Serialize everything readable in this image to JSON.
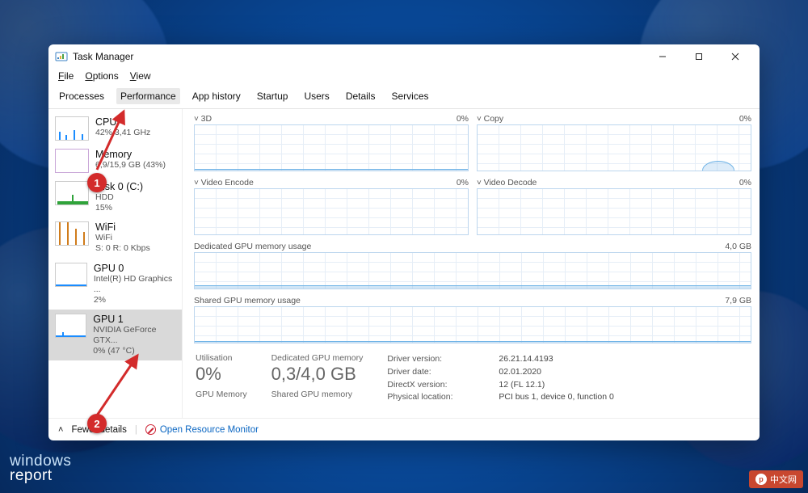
{
  "window": {
    "title": "Task Manager"
  },
  "menu": {
    "file": "File",
    "options": "Options",
    "view": "View"
  },
  "tabs": {
    "processes": "Processes",
    "performance": "Performance",
    "app_history": "App history",
    "startup": "Startup",
    "users": "Users",
    "details": "Details",
    "services": "Services"
  },
  "sidebar": {
    "cpu": {
      "name": "CPU",
      "sub": "42%  3,41 GHz"
    },
    "memory": {
      "name": "Memory",
      "sub": "6,9/15,9 GB (43%)"
    },
    "disk": {
      "name": "Disk 0 (C:)",
      "sub": "HDD\n15%"
    },
    "wifi": {
      "name": "WiFi",
      "sub": "WiFi\nS: 0 R: 0 Kbps"
    },
    "gpu0": {
      "name": "GPU 0",
      "sub": "Intel(R) HD Graphics ...\n2%"
    },
    "gpu1": {
      "name": "GPU 1",
      "sub": "NVIDIA GeForce GTX...\n0%  (47 °C)"
    }
  },
  "graphs": {
    "tl": {
      "name": "3D",
      "right": "0%"
    },
    "tr": {
      "name": "Copy",
      "right": "0%"
    },
    "ml": {
      "name": "Video Encode",
      "right": "0%"
    },
    "mr": {
      "name": "Video Decode",
      "right": "0%"
    },
    "dedicated": {
      "name": "Dedicated GPU memory usage",
      "right": "4,0 GB"
    },
    "shared": {
      "name": "Shared GPU memory usage",
      "right": "7,9 GB"
    }
  },
  "stats": {
    "util": {
      "label": "Utilisation",
      "value": "0%",
      "sublabel": "GPU Memory"
    },
    "dedmem": {
      "label": "Dedicated GPU memory",
      "value": "0,3/4,0 GB",
      "sublabel": "Shared GPU memory"
    },
    "kv": {
      "driver_version": {
        "k": "Driver version:",
        "v": "26.21.14.4193"
      },
      "driver_date": {
        "k": "Driver date:",
        "v": "02.01.2020"
      },
      "directx": {
        "k": "DirectX version:",
        "v": "12 (FL 12.1)"
      },
      "phys": {
        "k": "Physical location:",
        "v": "PCI bus 1, device 0, function 0"
      }
    }
  },
  "footer": {
    "fewer": "Fewer details",
    "monitor": "Open Resource Monitor"
  },
  "callouts": {
    "one": "1",
    "two": "2"
  },
  "brand": {
    "line1": "windows",
    "line2": "report"
  },
  "badge": {
    "text": "中文网"
  },
  "chart_data": [
    {
      "type": "line",
      "title": "3D",
      "ylim": [
        0,
        100
      ],
      "values": [
        1,
        1,
        2,
        1,
        1,
        2,
        1,
        1,
        1,
        1
      ],
      "unit": "%"
    },
    {
      "type": "line",
      "title": "Copy",
      "ylim": [
        0,
        100
      ],
      "values": [
        0,
        0,
        0,
        0,
        0,
        0,
        0,
        0,
        4,
        0
      ],
      "unit": "%"
    },
    {
      "type": "line",
      "title": "Video Encode",
      "ylim": [
        0,
        100
      ],
      "values": [
        0,
        0,
        0,
        0,
        0,
        0,
        0,
        0,
        0,
        0
      ],
      "unit": "%"
    },
    {
      "type": "line",
      "title": "Video Decode",
      "ylim": [
        0,
        100
      ],
      "values": [
        0,
        0,
        0,
        0,
        0,
        0,
        0,
        0,
        0,
        0
      ],
      "unit": "%"
    },
    {
      "type": "area",
      "title": "Dedicated GPU memory usage",
      "ylim": [
        0,
        4.0
      ],
      "values": [
        0.3,
        0.3,
        0.3,
        0.3,
        0.3,
        0.3,
        0.3,
        0.3,
        0.3,
        0.3
      ],
      "unit": "GB"
    },
    {
      "type": "area",
      "title": "Shared GPU memory usage",
      "ylim": [
        0,
        7.9
      ],
      "values": [
        0.0,
        0.0,
        0.0,
        0.0,
        0.0,
        0.0,
        0.0,
        0.0,
        0.0,
        0.0
      ],
      "unit": "GB"
    }
  ]
}
